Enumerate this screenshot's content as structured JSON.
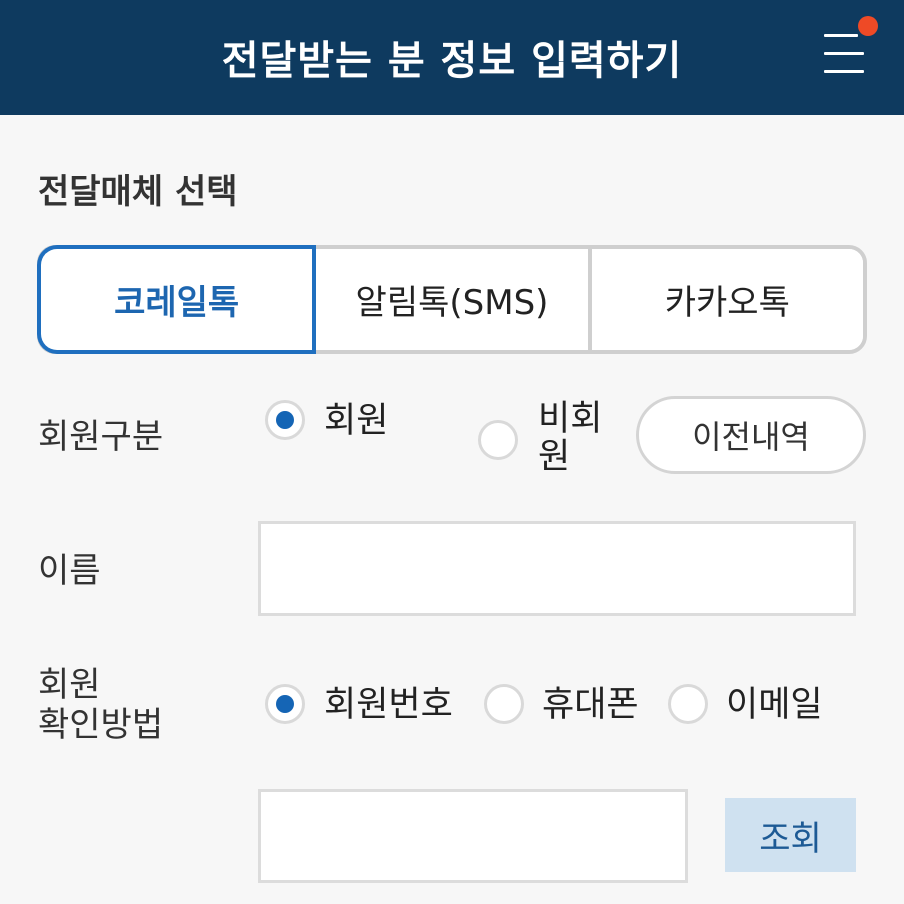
{
  "header": {
    "title": "전달받는 분 정보 입력하기",
    "menu_icon": "hamburger-menu-icon",
    "notification_color": "#ee4a26",
    "background_color": "#0e3a5f"
  },
  "delivery": {
    "section_title": "전달매체 선택",
    "options": [
      "코레일톡",
      "알림톡(SMS)",
      "카카오톡"
    ],
    "selected_index": 0
  },
  "member_type": {
    "label": "회원구분",
    "options": [
      "회원",
      "비회원"
    ],
    "options_display": [
      "회원",
      "비회\n원"
    ],
    "selected": "회원",
    "history_button": "이전내역"
  },
  "name": {
    "label": "이름",
    "value": "",
    "placeholder": ""
  },
  "verify": {
    "label_line1": "회원",
    "label_line2": "확인방법",
    "options": [
      "회원번호",
      "휴대폰",
      "이메일"
    ],
    "selected": "회원번호",
    "input_value": "",
    "lookup_button": "조회"
  },
  "colors": {
    "accent": "#1d66b0",
    "lookup_bg": "#cfe1f0"
  }
}
